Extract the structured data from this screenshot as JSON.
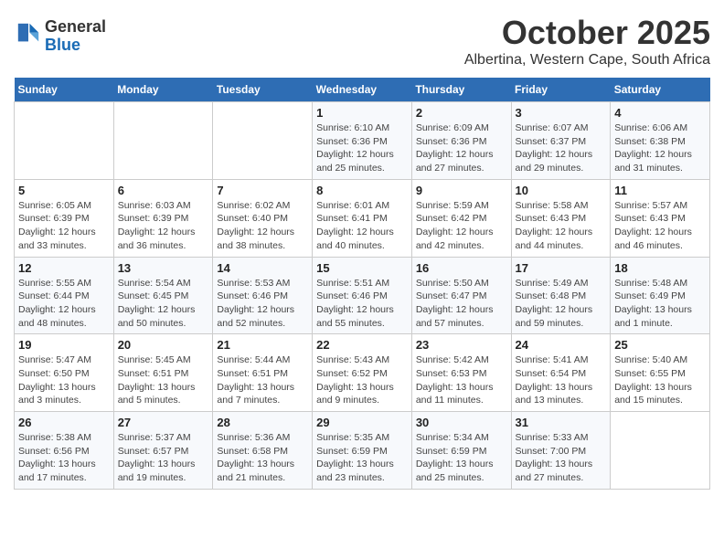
{
  "header": {
    "logo_line1": "General",
    "logo_line2": "Blue",
    "month": "October 2025",
    "location": "Albertina, Western Cape, South Africa"
  },
  "days_of_week": [
    "Sunday",
    "Monday",
    "Tuesday",
    "Wednesday",
    "Thursday",
    "Friday",
    "Saturday"
  ],
  "weeks": [
    [
      {
        "day": "",
        "info": ""
      },
      {
        "day": "",
        "info": ""
      },
      {
        "day": "",
        "info": ""
      },
      {
        "day": "1",
        "info": "Sunrise: 6:10 AM\nSunset: 6:36 PM\nDaylight: 12 hours\nand 25 minutes."
      },
      {
        "day": "2",
        "info": "Sunrise: 6:09 AM\nSunset: 6:36 PM\nDaylight: 12 hours\nand 27 minutes."
      },
      {
        "day": "3",
        "info": "Sunrise: 6:07 AM\nSunset: 6:37 PM\nDaylight: 12 hours\nand 29 minutes."
      },
      {
        "day": "4",
        "info": "Sunrise: 6:06 AM\nSunset: 6:38 PM\nDaylight: 12 hours\nand 31 minutes."
      }
    ],
    [
      {
        "day": "5",
        "info": "Sunrise: 6:05 AM\nSunset: 6:39 PM\nDaylight: 12 hours\nand 33 minutes."
      },
      {
        "day": "6",
        "info": "Sunrise: 6:03 AM\nSunset: 6:39 PM\nDaylight: 12 hours\nand 36 minutes."
      },
      {
        "day": "7",
        "info": "Sunrise: 6:02 AM\nSunset: 6:40 PM\nDaylight: 12 hours\nand 38 minutes."
      },
      {
        "day": "8",
        "info": "Sunrise: 6:01 AM\nSunset: 6:41 PM\nDaylight: 12 hours\nand 40 minutes."
      },
      {
        "day": "9",
        "info": "Sunrise: 5:59 AM\nSunset: 6:42 PM\nDaylight: 12 hours\nand 42 minutes."
      },
      {
        "day": "10",
        "info": "Sunrise: 5:58 AM\nSunset: 6:43 PM\nDaylight: 12 hours\nand 44 minutes."
      },
      {
        "day": "11",
        "info": "Sunrise: 5:57 AM\nSunset: 6:43 PM\nDaylight: 12 hours\nand 46 minutes."
      }
    ],
    [
      {
        "day": "12",
        "info": "Sunrise: 5:55 AM\nSunset: 6:44 PM\nDaylight: 12 hours\nand 48 minutes."
      },
      {
        "day": "13",
        "info": "Sunrise: 5:54 AM\nSunset: 6:45 PM\nDaylight: 12 hours\nand 50 minutes."
      },
      {
        "day": "14",
        "info": "Sunrise: 5:53 AM\nSunset: 6:46 PM\nDaylight: 12 hours\nand 52 minutes."
      },
      {
        "day": "15",
        "info": "Sunrise: 5:51 AM\nSunset: 6:46 PM\nDaylight: 12 hours\nand 55 minutes."
      },
      {
        "day": "16",
        "info": "Sunrise: 5:50 AM\nSunset: 6:47 PM\nDaylight: 12 hours\nand 57 minutes."
      },
      {
        "day": "17",
        "info": "Sunrise: 5:49 AM\nSunset: 6:48 PM\nDaylight: 12 hours\nand 59 minutes."
      },
      {
        "day": "18",
        "info": "Sunrise: 5:48 AM\nSunset: 6:49 PM\nDaylight: 13 hours\nand 1 minute."
      }
    ],
    [
      {
        "day": "19",
        "info": "Sunrise: 5:47 AM\nSunset: 6:50 PM\nDaylight: 13 hours\nand 3 minutes."
      },
      {
        "day": "20",
        "info": "Sunrise: 5:45 AM\nSunset: 6:51 PM\nDaylight: 13 hours\nand 5 minutes."
      },
      {
        "day": "21",
        "info": "Sunrise: 5:44 AM\nSunset: 6:51 PM\nDaylight: 13 hours\nand 7 minutes."
      },
      {
        "day": "22",
        "info": "Sunrise: 5:43 AM\nSunset: 6:52 PM\nDaylight: 13 hours\nand 9 minutes."
      },
      {
        "day": "23",
        "info": "Sunrise: 5:42 AM\nSunset: 6:53 PM\nDaylight: 13 hours\nand 11 minutes."
      },
      {
        "day": "24",
        "info": "Sunrise: 5:41 AM\nSunset: 6:54 PM\nDaylight: 13 hours\nand 13 minutes."
      },
      {
        "day": "25",
        "info": "Sunrise: 5:40 AM\nSunset: 6:55 PM\nDaylight: 13 hours\nand 15 minutes."
      }
    ],
    [
      {
        "day": "26",
        "info": "Sunrise: 5:38 AM\nSunset: 6:56 PM\nDaylight: 13 hours\nand 17 minutes."
      },
      {
        "day": "27",
        "info": "Sunrise: 5:37 AM\nSunset: 6:57 PM\nDaylight: 13 hours\nand 19 minutes."
      },
      {
        "day": "28",
        "info": "Sunrise: 5:36 AM\nSunset: 6:58 PM\nDaylight: 13 hours\nand 21 minutes."
      },
      {
        "day": "29",
        "info": "Sunrise: 5:35 AM\nSunset: 6:59 PM\nDaylight: 13 hours\nand 23 minutes."
      },
      {
        "day": "30",
        "info": "Sunrise: 5:34 AM\nSunset: 6:59 PM\nDaylight: 13 hours\nand 25 minutes."
      },
      {
        "day": "31",
        "info": "Sunrise: 5:33 AM\nSunset: 7:00 PM\nDaylight: 13 hours\nand 27 minutes."
      },
      {
        "day": "",
        "info": ""
      }
    ]
  ]
}
